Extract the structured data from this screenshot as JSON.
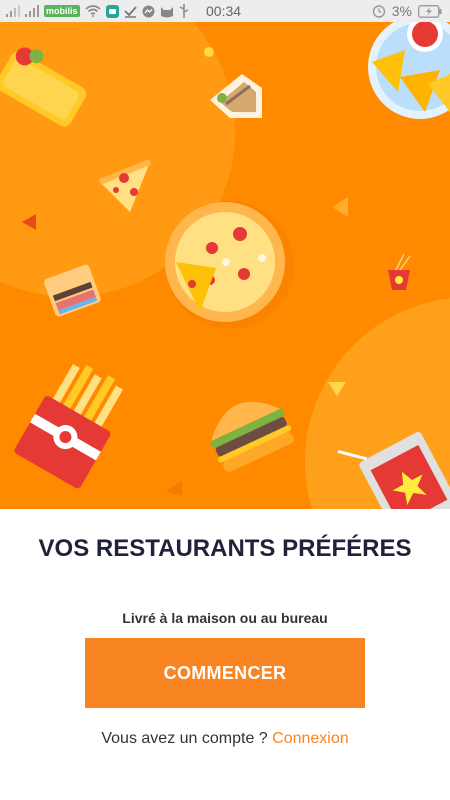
{
  "status_bar": {
    "carrier_badge": "mobilis",
    "time": "00:34",
    "battery": "3%",
    "icons": [
      "signal-icon",
      "signal-icon",
      "wifi-icon",
      "chat-icon",
      "check-icon",
      "messenger-icon",
      "cat-icon",
      "usb-icon",
      "alarm-icon",
      "battery-charging-icon"
    ]
  },
  "hero": {
    "background_color": "#ff8a00",
    "illustrations": [
      "wrap-icon",
      "sandwich-icon",
      "nachos-plate-icon",
      "pizza-slice-icon",
      "pizza-icon",
      "noodle-box-icon",
      "cake-icon",
      "fries-icon",
      "burger-icon",
      "drink-cup-icon"
    ]
  },
  "main": {
    "title": "VOS RESTAURANTS PRÉFÉRES",
    "subtitle": "Livré à la maison ou au bureau",
    "cta_label": "COMMENCER",
    "account_prompt": "Vous avez un compte ?",
    "login_link": "Connexion"
  },
  "colors": {
    "accent": "#f98522",
    "title": "#1f2238"
  }
}
